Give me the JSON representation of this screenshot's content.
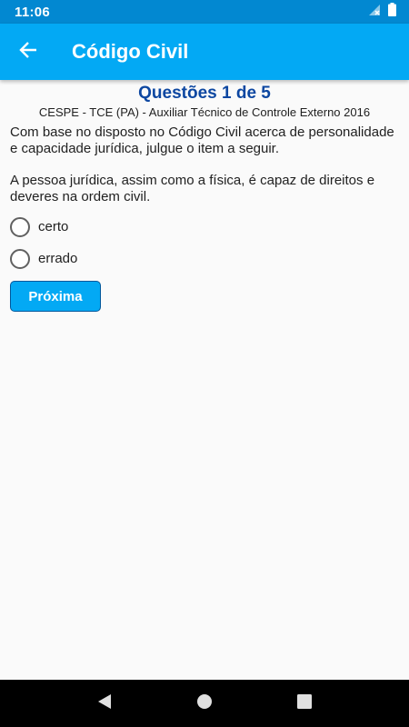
{
  "status_bar": {
    "time": "11:06",
    "icons": [
      "signal-off-icon",
      "battery-icon"
    ]
  },
  "app_bar": {
    "back_icon": "arrow-back-icon",
    "title": "Código Civil"
  },
  "question": {
    "heading": "Questões 1 de 5",
    "source": "CESPE - TCE (PA) - Auxiliar Técnico de Controle Externo 2016",
    "statement": "Com base no disposto no Código Civil acerca de personalidade e capacidade jurídica, julgue o item a seguir.",
    "item": "A pessoa jurídica, assim como a física, é capaz de direitos e deveres na ordem civil.",
    "options": [
      {
        "label": "certo",
        "selected": false
      },
      {
        "label": "errado",
        "selected": false
      }
    ],
    "next_label": "Próxima"
  },
  "nav_bar": {
    "icons": [
      "back-triangle-icon",
      "home-circle-icon",
      "recents-square-icon"
    ]
  },
  "colors": {
    "status_bar": "#0288d1",
    "app_bar": "#03a9f4",
    "heading": "#0d47a1",
    "button": "#03a9f4"
  }
}
